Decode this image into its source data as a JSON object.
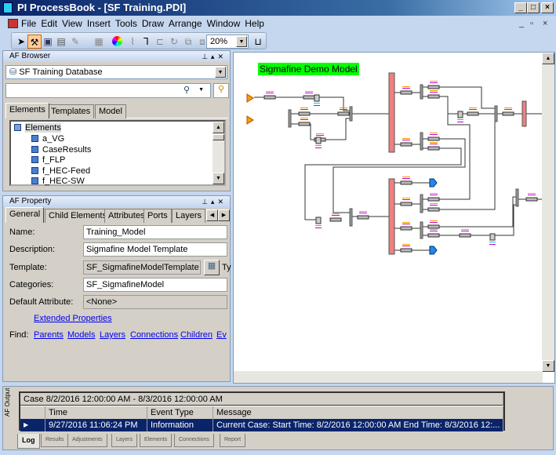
{
  "window": {
    "title": "PI ProcessBook - [SF Training.PDI]",
    "buttons": [
      "_",
      "□",
      "×"
    ]
  },
  "menu": {
    "items": [
      "File",
      "Edit",
      "View",
      "Insert",
      "Tools",
      "Draw",
      "Arrange",
      "Window",
      "Help"
    ]
  },
  "toolbar": {
    "zoom": "20%",
    "icons": [
      "pointer-icon",
      "hammer-icon",
      "save-icon",
      "image-icon",
      "color-wheel-icon",
      "connector-icon"
    ]
  },
  "af_browser": {
    "title": "AF Browser",
    "database": "SF Training Database",
    "search_placeholder": "",
    "tabs": [
      "Elements",
      "Templates",
      "Model"
    ],
    "tree": {
      "root": "Elements",
      "items": [
        "a_VG",
        "CaseResults",
        "f_FLP",
        "f_HEC-Feed",
        "f_HEC-SW"
      ]
    }
  },
  "af_property": {
    "title": "AF Property",
    "tabs": [
      "General",
      "Child Elements",
      "Attributes",
      "Ports",
      "Layers"
    ],
    "fields": [
      {
        "label": "Name:",
        "value": "Training_Model"
      },
      {
        "label": "Description:",
        "value": "Sigmafine Model Template"
      },
      {
        "label": "Template:",
        "value": "SF_SigmafineModelTemplate"
      },
      {
        "label": "Categories:",
        "value": "SF_SigmafineModel"
      },
      {
        "label": "Default Attribute:",
        "value": "<None>"
      }
    ],
    "template_suffix": "Ty",
    "extended_link": "Extended Properties",
    "find_label": "Find:",
    "find_links": [
      "Parents",
      "Models",
      "Layers",
      "Connections",
      "Children",
      "Ev"
    ]
  },
  "canvas": {
    "title": "Sigmafine Demo Model",
    "title_bg": "#00ff00",
    "vessel_color": "#f08080"
  },
  "output": {
    "side_label": "AF Output",
    "case": "Case 8/2/2016 12:00:00 AM  -  8/3/2016 12:00:00 AM",
    "columns": [
      "Time",
      "Event Type",
      "Message"
    ],
    "rows": [
      {
        "time": "9/27/2016 11:06:24 PM",
        "type": "Information",
        "message": "Current Case:  Start Time: 8/2/2016 12:00:00 AM End Time: 8/3/2016 12:..."
      }
    ],
    "tabs": [
      "Log",
      "Results",
      "Adjustments",
      "Layers",
      "Elements",
      "Connections",
      "Report"
    ]
  }
}
